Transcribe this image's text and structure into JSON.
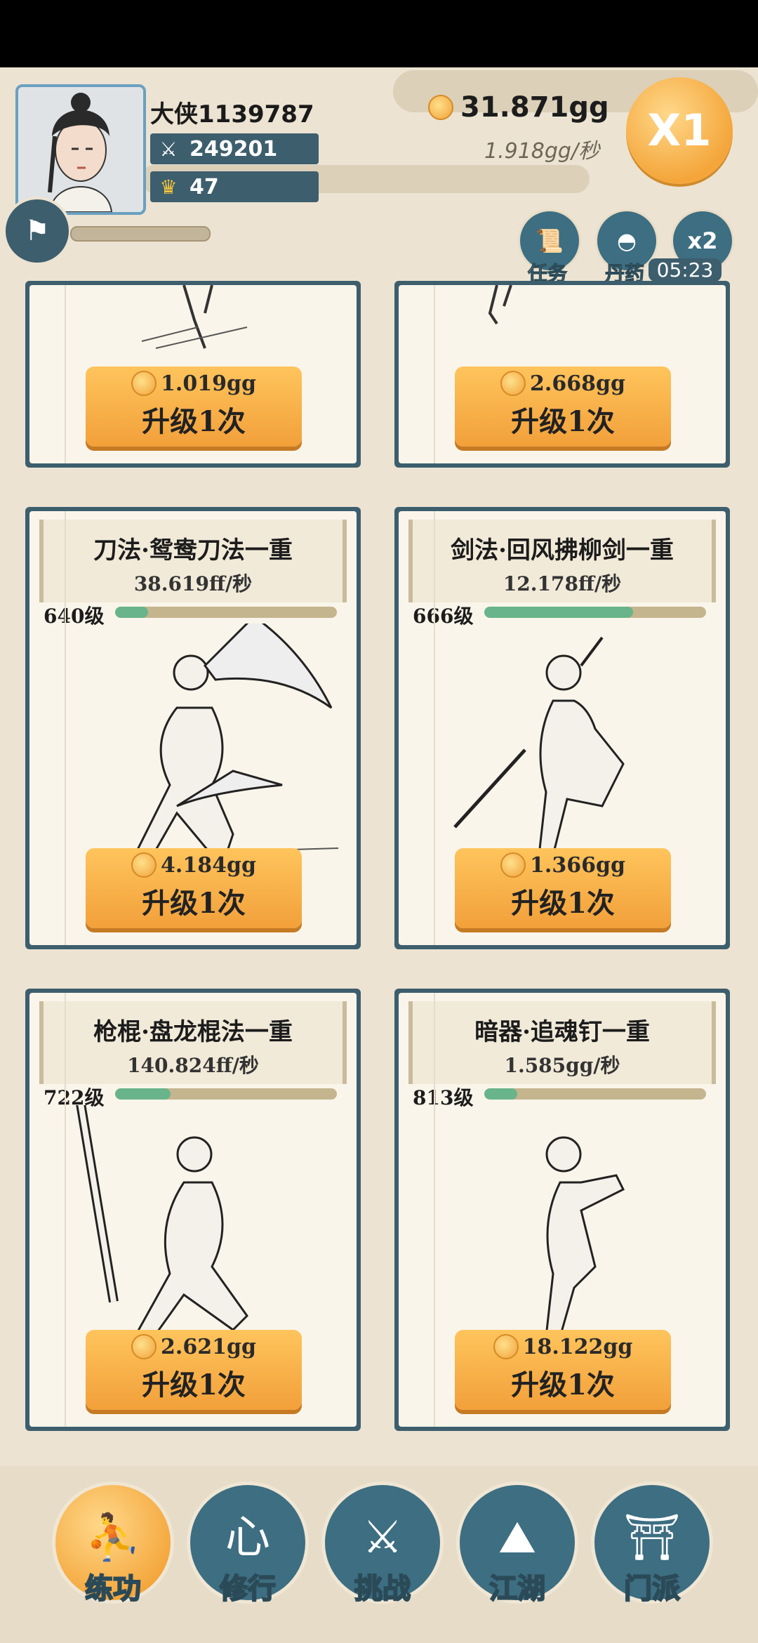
{
  "header": {
    "player_name": "大侠1139787",
    "combat_power": "249201",
    "ingots": "47",
    "gold_total": "31.871gg",
    "gold_rate": "1.918gg/秒",
    "multiplier": "X1"
  },
  "quick_actions": [
    {
      "icon": "scroll-icon",
      "label": "任务"
    },
    {
      "icon": "pill-icon",
      "label": "丹药"
    },
    {
      "icon": "double-speed-icon",
      "label": "x2",
      "timer": "05:23"
    }
  ],
  "cards_partial": [
    {
      "cost": "1.019gg",
      "button": "升级1次"
    },
    {
      "cost": "2.668gg",
      "button": "升级1次"
    }
  ],
  "cards": [
    {
      "name": "刀法·鸳鸯刀法一重",
      "rate": "38.619ff/秒",
      "level": "640级",
      "progress": 0.15,
      "cost": "4.184gg",
      "button": "升级1次",
      "figure": "saber-fighter"
    },
    {
      "name": "剑法·回风拂柳剑一重",
      "rate": "12.178ff/秒",
      "level": "666级",
      "progress": 0.67,
      "cost": "1.366gg",
      "button": "升级1次",
      "figure": "sword-fighter"
    },
    {
      "name": "枪棍·盘龙棍法一重",
      "rate": "140.824ff/秒",
      "level": "722级",
      "progress": 0.25,
      "cost": "2.621gg",
      "button": "升级1次",
      "figure": "staff-fighter"
    },
    {
      "name": "暗器·追魂钉一重",
      "rate": "1.585gg/秒",
      "level": "813级",
      "progress": 0.15,
      "cost": "18.122gg",
      "button": "升级1次",
      "figure": "dart-thrower"
    }
  ],
  "nav": [
    {
      "label": "练功",
      "icon": "martial-stance-icon",
      "active": true
    },
    {
      "label": "修行",
      "icon": "heart-glyph-icon",
      "active": false
    },
    {
      "label": "挑战",
      "icon": "crossed-swords-icon",
      "active": false
    },
    {
      "label": "江湖",
      "icon": "mountain-icon",
      "active": false
    },
    {
      "label": "门派",
      "icon": "gate-icon",
      "active": false
    }
  ],
  "colors": {
    "panel": "#3d5e6d",
    "accent": "#f4a63b",
    "progress": "#69b48a"
  }
}
